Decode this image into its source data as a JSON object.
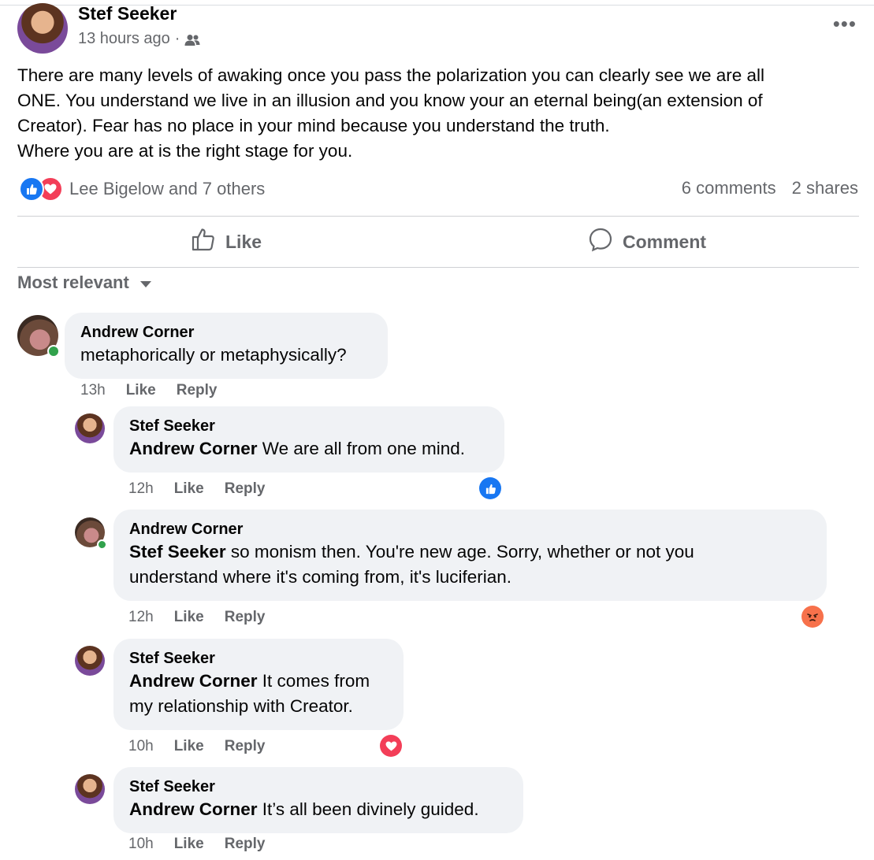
{
  "post": {
    "author": "Stef Seeker",
    "time": "13 hours ago",
    "separator": "·",
    "body_lines": [
      "There are many levels of awaking once you pass the polarization you can clearly see we are all",
      "ONE. You understand we live in an illusion and you know your an eternal being(an extension of",
      "Creator). Fear has no place in your mind because you understand the truth.",
      "Where you are at is the right stage for you."
    ],
    "reactions_text": "Lee Bigelow and 7 others",
    "comments_count": "6 comments",
    "shares_count": "2 shares"
  },
  "actions": {
    "like": "Like",
    "comment": "Comment"
  },
  "sort_label": "Most relevant",
  "comments": [
    {
      "author": "Andrew Corner",
      "mention": "",
      "text": "metaphorically or metaphysically?",
      "time": "13h",
      "like": "Like",
      "reply": "Reply"
    },
    {
      "author": "Stef Seeker",
      "mention": "Andrew Corner",
      "text": "We are all from one mind.",
      "time": "12h",
      "like": "Like",
      "reply": "Reply"
    },
    {
      "author": "Andrew Corner",
      "mention": "Stef Seeker",
      "text": "so monism then. You're new age. Sorry, whether or not you",
      "text2": "understand where it's coming from, it's luciferian.",
      "time": "12h",
      "like": "Like",
      "reply": "Reply"
    },
    {
      "author": "Stef Seeker",
      "mention": "Andrew Corner",
      "text": "It comes from",
      "text2": "my relationship with Creator.",
      "time": "10h",
      "like": "Like",
      "reply": "Reply"
    },
    {
      "author": "Stef Seeker",
      "mention": "Andrew Corner",
      "text": "It’s all been divinely guided.",
      "time": "10h",
      "like": "Like",
      "reply": "Reply"
    }
  ],
  "colors": {
    "like_blue": "#1877f2",
    "love_red": "#f33e58",
    "angry_orange": "#f7714b",
    "bubble_bg": "#f0f2f5",
    "muted": "#65676b"
  }
}
